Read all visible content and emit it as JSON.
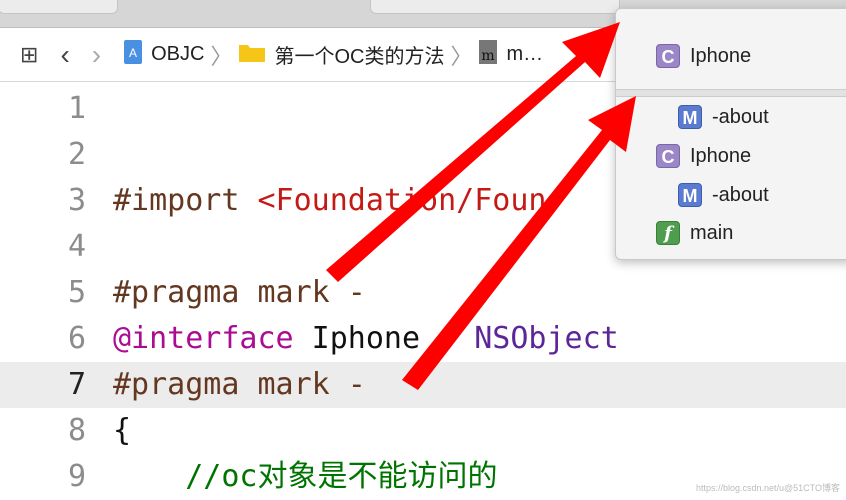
{
  "breadcrumb": {
    "project": "OBJC",
    "folder": "第一个OC类的方法",
    "file": "m…"
  },
  "code_lines": [
    {
      "n": "1",
      "parts": []
    },
    {
      "n": "2",
      "parts": []
    },
    {
      "n": "3",
      "parts": [
        [
          "pp",
          "#import "
        ],
        [
          "str",
          "<Foundation/Foun"
        ]
      ]
    },
    {
      "n": "4",
      "parts": []
    },
    {
      "n": "5",
      "parts": [
        [
          "pp",
          "#pragma mark -"
        ]
      ]
    },
    {
      "n": "6",
      "parts": [
        [
          "kw",
          "@interface"
        ],
        [
          "pl",
          " Iphone : "
        ],
        [
          "cls",
          "NSObject"
        ]
      ]
    },
    {
      "n": "7",
      "parts": [
        [
          "pp",
          "#pragma mark -"
        ]
      ],
      "current": true
    },
    {
      "n": "8",
      "parts": [
        [
          "pl",
          "{"
        ]
      ]
    },
    {
      "n": "9",
      "parts": [
        [
          "pl",
          "    "
        ],
        [
          "cm",
          "//oc对象是不能访问的"
        ]
      ]
    }
  ],
  "popup": {
    "items": [
      {
        "badge": "C",
        "label": "Iphone"
      },
      {
        "badge": "M",
        "label": "-about"
      },
      {
        "badge": "C",
        "label": "Iphone"
      },
      {
        "badge": "M",
        "label": "-about"
      },
      {
        "badge": "f",
        "label": "main"
      }
    ]
  },
  "watermark": "https://blog.csdn.net/u@51CTO博客",
  "colors": {
    "arrow": "#ff0000",
    "current_line": "#ececec"
  }
}
